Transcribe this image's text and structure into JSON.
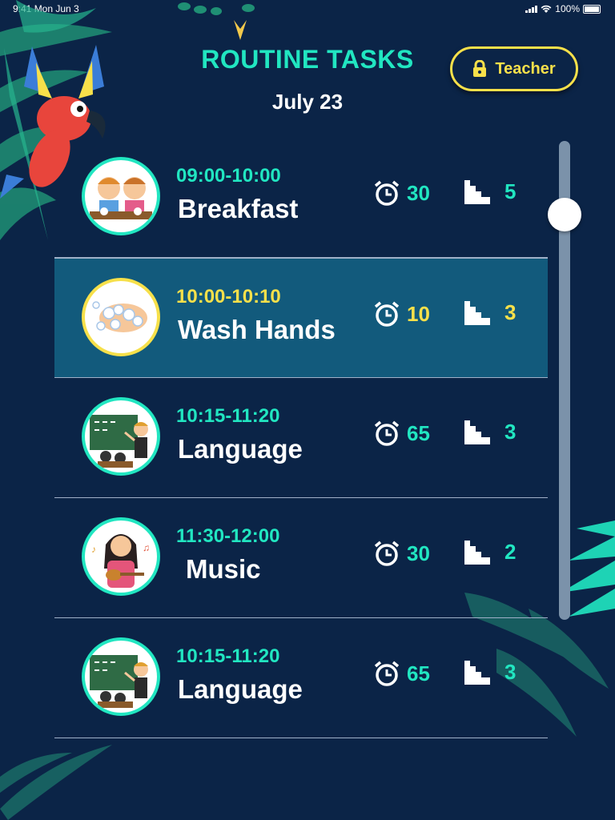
{
  "status": {
    "time": "9:41 Mon Jun 3",
    "battery": "100%"
  },
  "header": {
    "title": "ROUTINE TASKS",
    "date": "July 23",
    "teacher_button": "Teacher"
  },
  "tasks": [
    {
      "time": "09:00-10:00",
      "name": "Breakfast",
      "duration": "30",
      "steps": "5",
      "image": "kids-eating-breakfast",
      "selected": false
    },
    {
      "time": "10:00-10:10",
      "name": "Wash Hands",
      "duration": "10",
      "steps": "3",
      "image": "washing-hands",
      "selected": true
    },
    {
      "time": "10:15-11:20",
      "name": "Language",
      "duration": "65",
      "steps": "3",
      "image": "teacher-at-chalkboard",
      "selected": false
    },
    {
      "time": "11:30-12:00",
      "name": "Music",
      "duration": "30",
      "steps": "2",
      "image": "girl-playing-ukulele",
      "selected": false
    },
    {
      "time": "10:15-11:20",
      "name": "Language",
      "duration": "65",
      "steps": "3",
      "image": "teacher-at-chalkboard",
      "selected": false
    }
  ],
  "colors": {
    "background": "#0b2447",
    "accent": "#21e6c1",
    "highlight": "#f7e04a",
    "selected_row": "#125a7c"
  },
  "scroll": {
    "position": 0.12
  }
}
